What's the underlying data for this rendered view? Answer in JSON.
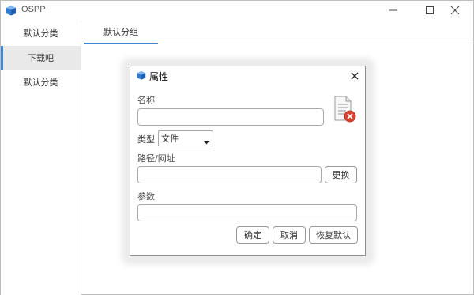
{
  "window": {
    "title": "OSPP"
  },
  "sidebar": {
    "items": [
      {
        "label": "默认分类",
        "active": false
      },
      {
        "label": "下载吧",
        "active": true
      },
      {
        "label": "默认分类",
        "active": false
      }
    ]
  },
  "tabs": [
    {
      "label": "默认分组",
      "active": true
    }
  ],
  "dialog": {
    "title": "属性",
    "name_label": "名称",
    "name_value": "",
    "type_label": "类型",
    "type_selected": "文件",
    "path_label": "路径/网址",
    "path_value": "",
    "change_button": "更换",
    "params_label": "参数",
    "params_value": "",
    "ok_button": "确定",
    "cancel_button": "取消",
    "reset_button": "恢复默认"
  },
  "colors": {
    "accent": "#3d86d6",
    "error_red": "#d9412e"
  }
}
